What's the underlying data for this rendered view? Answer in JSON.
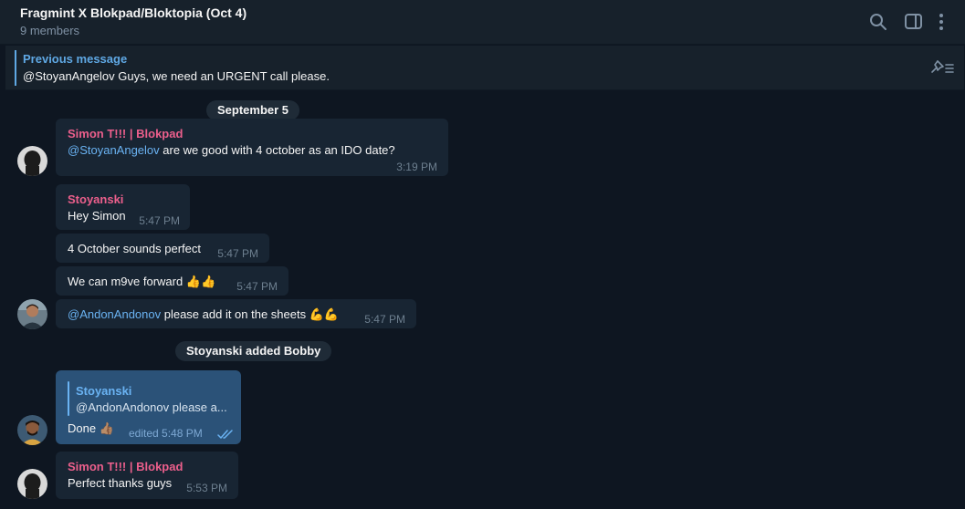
{
  "header": {
    "title": "Fragmint X Blokpad/Bloktopia (Oct 4)",
    "subtitle": "9 members",
    "icons": [
      "search-icon",
      "sidebar-toggle-icon",
      "more-vertical-icon"
    ]
  },
  "pinned": {
    "title": "Previous message",
    "text": "@StoyanAngelov Guys, we need an URGENT call please.",
    "icon": "pinned-list-icon"
  },
  "date_separator": "September 5",
  "messages": [
    {
      "sender": "Simon T!!! | Blokpad",
      "mention": "@StoyanAngelov",
      "text": " are we good with 4 october as an IDO date?",
      "time": "3:19 PM"
    },
    {
      "sender": "Stoyanski",
      "text": "Hey Simon",
      "time": "5:47 PM"
    },
    {
      "text": "4 October sounds perfect",
      "time": "5:47 PM"
    },
    {
      "text": "We can m9ve forward 👍👍",
      "time": "5:47 PM"
    },
    {
      "mention": "@AndonAndonov",
      "text": " please add it on the sheets 💪💪",
      "time": "5:47 PM"
    },
    {
      "reply_name": "Stoyanski",
      "reply_text": "@AndonAndonov please a...",
      "text": "Done 👍🏽",
      "time": "edited 5:48 PM",
      "status": "read"
    },
    {
      "sender": "Simon T!!! | Blokpad",
      "text": "Perfect thanks guys",
      "time": "5:53 PM"
    }
  ],
  "service_message": "Stoyanski added Bobby",
  "colors": {
    "background": "#0e1621",
    "header": "#17212b",
    "bubble_in": "#182533",
    "bubble_out": "#2b5278",
    "sender_name": "#ec5f8c",
    "link": "#6ab3f3"
  }
}
